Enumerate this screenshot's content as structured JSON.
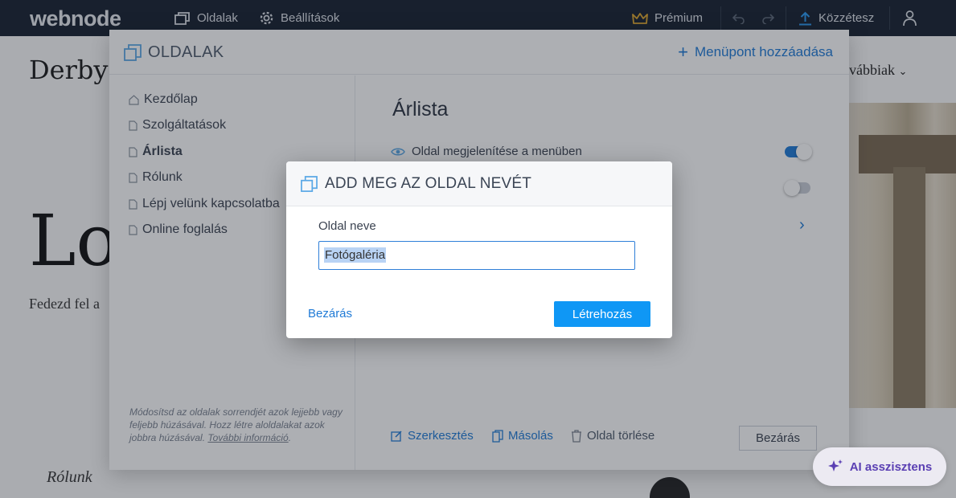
{
  "topbar": {
    "logo": "webnode",
    "pages": "Oldalak",
    "settings": "Beállítások",
    "premium": "Prémium",
    "publish": "Közzétesz"
  },
  "site": {
    "title": "Derby I",
    "big": "Lo",
    "subtitle": "Fedezd fel a",
    "more": "vábbiak",
    "rolunk": "Rólunk"
  },
  "panel": {
    "title": "OLDALAK",
    "add_menu": "Menüpont hozzáadása",
    "pages": [
      {
        "label": "Kezdőlap",
        "icon": "home-icon"
      },
      {
        "label": "Szolgáltatások",
        "icon": "page-icon"
      },
      {
        "label": "Árlista",
        "icon": "page-icon"
      },
      {
        "label": "Rólunk",
        "icon": "page-icon"
      },
      {
        "label": "Lépj velünk kapcsolatba",
        "icon": "page-icon"
      },
      {
        "label": "Online foglalás",
        "icon": "page-icon"
      }
    ],
    "note": "Módosítsd az oldalak sorrendjét azok lejjebb vagy feljebb húzásával. Hozz létre aloldalakat azok jobbra húzásával.",
    "note_link": "További információ",
    "selected_page": "Árlista",
    "show_in_menu": "Oldal megjelenítése a menüben",
    "edit": "Szerkesztés",
    "copy": "Másolás",
    "delete": "Oldal törlése",
    "close": "Bezárás"
  },
  "ai": {
    "label": "AI asszisztens"
  },
  "modal": {
    "title": "ADD MEG AZ OLDAL NEVÉT",
    "field_label": "Oldal neve",
    "field_value": "Fotógaléria",
    "close": "Bezárás",
    "create": "Létrehozás"
  },
  "colors": {
    "accent": "#0f97f5",
    "link": "#1f7ad6",
    "topbar": "#16202f",
    "premium": "#e0a82e",
    "ai": "#5a3fb3"
  }
}
